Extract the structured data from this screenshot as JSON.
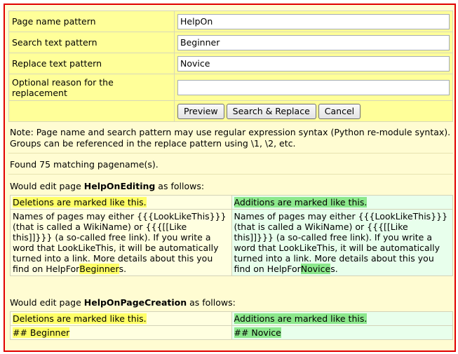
{
  "form": {
    "page_name_label": "Page name pattern",
    "page_name_value": "HelpOn",
    "search_label": "Search text pattern",
    "search_value": "Beginner",
    "replace_label": "Replace text pattern",
    "replace_value": "Novice",
    "reason_label": "Optional reason for the replacement",
    "reason_value": "",
    "preview_label": "Preview",
    "search_replace_label": "Search & Replace",
    "cancel_label": "Cancel"
  },
  "note": "Note: Page name and search pattern may use regular expression syntax (Python re-module syntax). Groups can be referenced in the replace pattern using \\1, \\2, etc.",
  "found": "Found 75 matching pagename(s).",
  "edits": [
    {
      "prefix": "Would edit page ",
      "page": "HelpOnEditing",
      "suffix": " as follows:",
      "deletions_header": "Deletions are marked like this.",
      "additions_header": "Additions are marked like this.",
      "old_text_before": "Names of pages may either {{{LookLikeThis}}} (that is called a WikiName) or {{{[[Like this]]}}} (a so-called free link). If you write a word that LookLikeThis, it will be automatically turned into a link. More details about this you find on HelpFor",
      "old_changed": "Beginner",
      "old_text_after": "s.",
      "new_text_before": "Names of pages may either {{{LookLikeThis}}} (that is called a WikiName) or {{{[[Like this]]}}} (a so-called free link). If you write a word that LookLikeThis, it will be automatically turned into a link. More details about this you find on HelpFor",
      "new_changed": "Novice",
      "new_text_after": "s."
    },
    {
      "prefix": "Would edit page ",
      "page": "HelpOnPageCreation",
      "suffix": " as follows:",
      "deletions_header": "Deletions are marked like this.",
      "additions_header": "Additions are marked like this.",
      "old_line": "## Beginner",
      "new_line": "## Novice"
    }
  ],
  "colors": {
    "frame_border": "#e00000",
    "background": "#fffcd2",
    "deletion_highlight": "#ffff66",
    "addition_highlight": "#8ce88c"
  }
}
